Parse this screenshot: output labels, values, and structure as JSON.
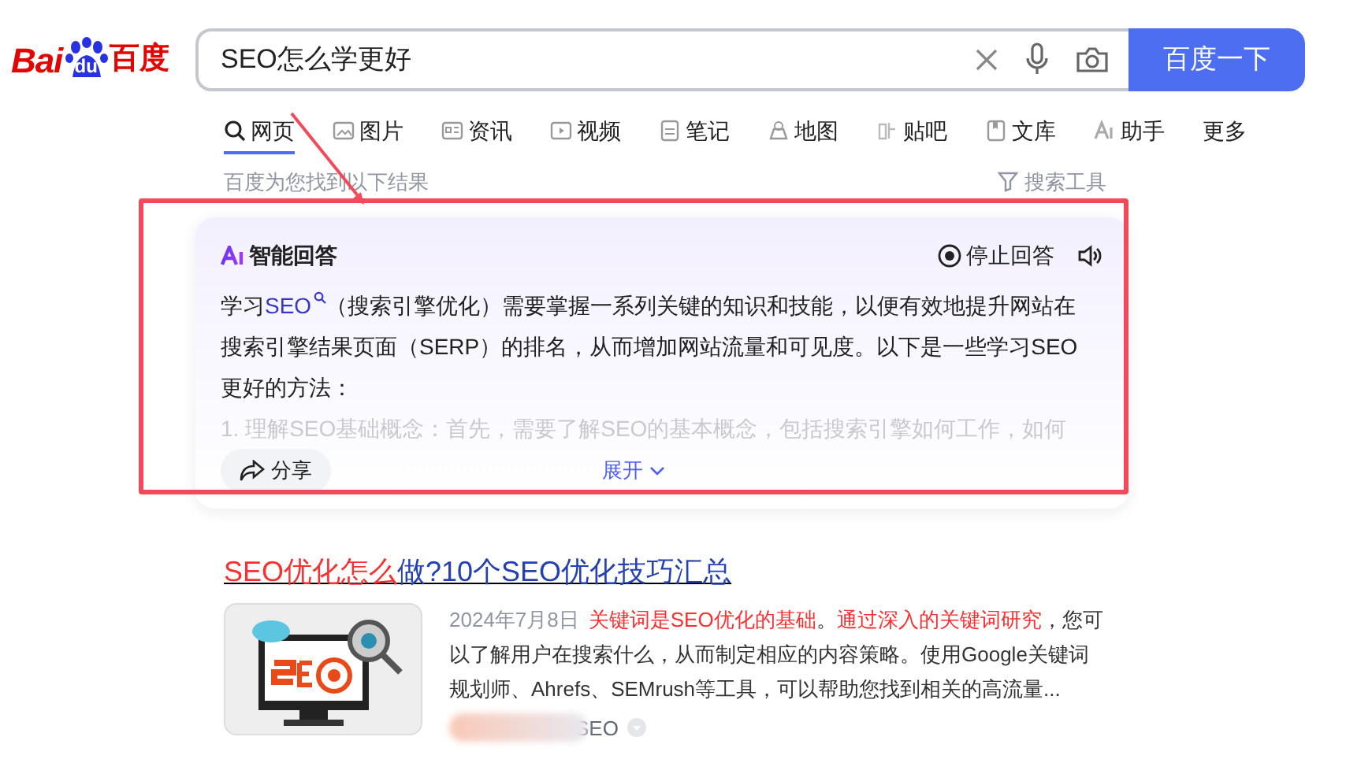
{
  "logo": {
    "part_1": "Bai",
    "part_2": "du",
    "part_3": "百度"
  },
  "search": {
    "value": "SEO怎么学更好",
    "button": "百度一下"
  },
  "tabs": [
    {
      "label": "网页",
      "selected": true
    },
    {
      "label": "图片",
      "selected": false
    },
    {
      "label": "资讯",
      "selected": false
    },
    {
      "label": "视频",
      "selected": false
    },
    {
      "label": "笔记",
      "selected": false
    },
    {
      "label": "地图",
      "selected": false
    },
    {
      "label": "贴吧",
      "selected": false
    },
    {
      "label": "文库",
      "selected": false
    },
    {
      "label": "助手",
      "selected": false
    },
    {
      "label": "更多",
      "selected": false
    }
  ],
  "result_count": "百度为您找到以下结果",
  "search_tools": "搜索工具",
  "ai_answer": {
    "title": "智能回答",
    "stop": "停止回答",
    "paragraph": [
      {
        "text": "学习",
        "link": false
      },
      {
        "text": "SEO",
        "link": true
      },
      {
        "text": "（搜索引擎优化）需要掌握一系列关键的知识和技能，以便有效地提升网站在搜索引擎结果页面（SERP）的排名，从而增加网站流量和可见度。以下是一些学习SEO更好的方法：",
        "link": false
      }
    ],
    "faded_line": "1. 理解SEO基础概念：首先，需要了解SEO的基本概念，包括搜索引擎如何工作，如何",
    "share": "分享",
    "expand": "展开"
  },
  "result": {
    "title": [
      {
        "text": "SEO优化怎么",
        "highlight": true
      },
      {
        "text": "做?10个SEO优化技巧汇总",
        "highlight": false
      }
    ],
    "date": "2024年7月8日",
    "snippet": [
      {
        "text": "关键词是SEO优化的基础",
        "highlight": true
      },
      {
        "text": "。",
        "highlight": false
      },
      {
        "text": "通过深入的关键词研究",
        "highlight": true
      },
      {
        "text": "，您可以了解用户在搜索什么，从而制定相应的内容策略。使用Google关键词规划师、Ahrefs、SEMrush等工具，可以帮助您找到相关的高流量...",
        "highlight": false
      }
    ],
    "source": "SEO"
  }
}
